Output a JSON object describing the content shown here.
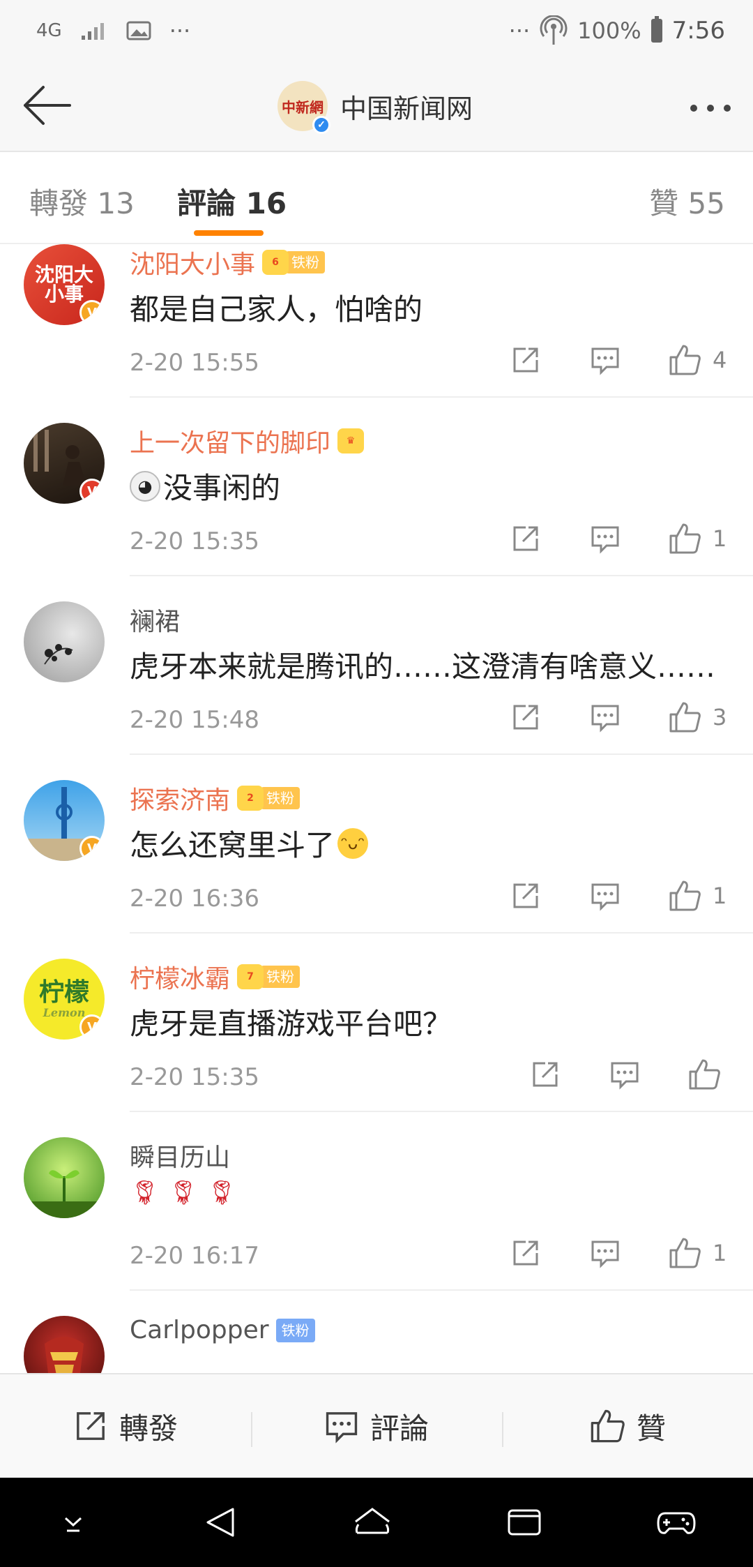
{
  "status_bar": {
    "network": "4G",
    "more": "···",
    "more_right": "···",
    "battery": "100%",
    "time": "7:56"
  },
  "header": {
    "title": "中国新闻网",
    "avatar_text": "中新網"
  },
  "tabs": [
    {
      "label": "轉發 13"
    },
    {
      "label": "評論 16"
    },
    {
      "label": "贊 55"
    }
  ],
  "comments": [
    {
      "name": "沈阳大小事",
      "badge": "铁粉",
      "crown_level": "6",
      "avatar_text": "沈阳大小事",
      "text": "都是自己家人，怕啥的",
      "time": "2-20 15:55",
      "likes": "4"
    },
    {
      "name": "上一次留下的脚印",
      "badge": "",
      "crown_level": "",
      "avatar_text": "",
      "text": "没事闲的",
      "time": "2-20 15:35",
      "likes": "1"
    },
    {
      "name": "襕裙",
      "badge": "",
      "crown_level": "",
      "avatar_text": "",
      "text": "虎牙本来就是腾讯的……这澄清有啥意义……",
      "time": "2-20 15:48",
      "likes": "3"
    },
    {
      "name": "探索济南",
      "badge": "铁粉",
      "crown_level": "2",
      "avatar_text": "",
      "text": "怎么还窝里斗了",
      "time": "2-20 16:36",
      "likes": "1"
    },
    {
      "name": "柠檬冰霸",
      "badge": "铁粉",
      "crown_level": "7",
      "avatar_text": "柠檬",
      "avatar_sub": "Lemon",
      "text": "虎牙是直播游戏平台吧？",
      "time": "2-20 15:35",
      "likes": ""
    },
    {
      "name": "瞬目历山",
      "badge": "",
      "crown_level": "",
      "avatar_text": "",
      "text": "",
      "time": "2-20 16:17",
      "likes": "1"
    },
    {
      "name": "Carlpopper",
      "badge": "铁粉",
      "crown_level": "",
      "avatar_text": "",
      "text": "",
      "time": "",
      "likes": ""
    }
  ],
  "bottom_bar": {
    "repost": "轉發",
    "comment": "評論",
    "like": "贊"
  },
  "colors": {
    "accent": "#ff8200",
    "username_orange": "#eb7350",
    "verified_orange": "#f6a623",
    "verified_red": "#e23b2a",
    "verified_blue": "#2f8cf0"
  }
}
